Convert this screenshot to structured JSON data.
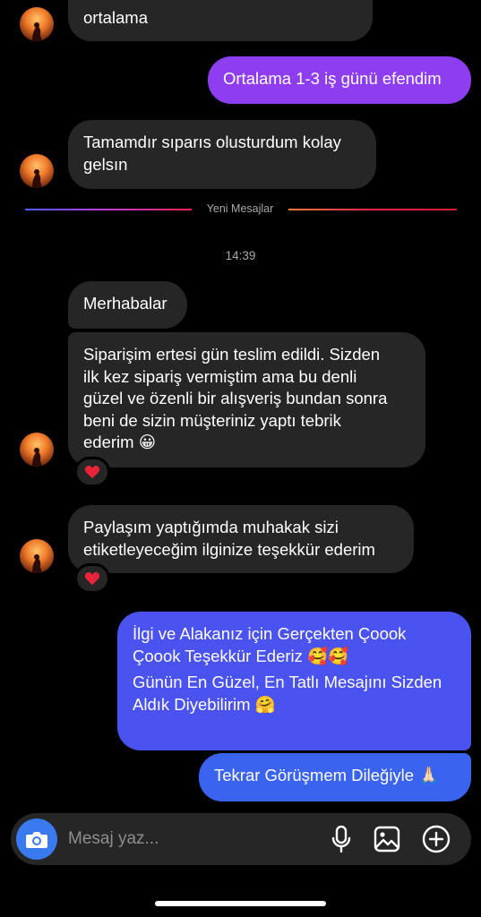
{
  "messages": {
    "m1": {
      "lines": [
        "ortalama"
      ]
    },
    "m2": {
      "lines": [
        "Ortalama 1-3 iş günü efendim"
      ]
    },
    "m3": {
      "lines": [
        "Tamamdır sıparıs olusturdum kolay",
        "gelsın"
      ]
    },
    "m4": {
      "lines": [
        "Merhabalar"
      ]
    },
    "m5": {
      "lines": [
        "Siparişim ertesi gün teslim edildi. Sizden",
        "ilk kez sipariş vermiştim ama bu denli",
        "güzel ve özenli bir alışveriş bundan sonra",
        "beni de sizin müşteriniz yaptı tebrik",
        "ederim 😀"
      ]
    },
    "m6": {
      "lines": [
        "Paylaşım yaptığımda muhakak sizi",
        "etiketleyeceğim ilginize teşekkür ederim"
      ]
    },
    "m7": {
      "lines": [
        "İlgi ve Alakanız için Gerçekten Çoook",
        "Çoook Teşekkür Ederiz 🥰🥰",
        "",
        "Günün En Güzel, En Tatlı Mesajını Sizden",
        "Aldık Diyebilirim 🤗"
      ]
    },
    "m8": {
      "lines": [
        "Tekrar Görüşmem Dileğiyle 🙏🏻"
      ]
    }
  },
  "divider": {
    "label": "Yeni Mesajlar"
  },
  "timestamp": "14:39",
  "composer": {
    "placeholder": "Mesaj yaz..."
  },
  "colors": {
    "incoming_bubble": "#262626",
    "outgoing_purple": "#8e3df0",
    "outgoing_blue": "#3a63f0",
    "reaction_heart": "#e8233a"
  },
  "icons": {
    "camera": "camera-icon",
    "mic": "microphone-icon",
    "gallery": "gallery-icon",
    "add": "add-icon",
    "heart": "heart-icon"
  }
}
